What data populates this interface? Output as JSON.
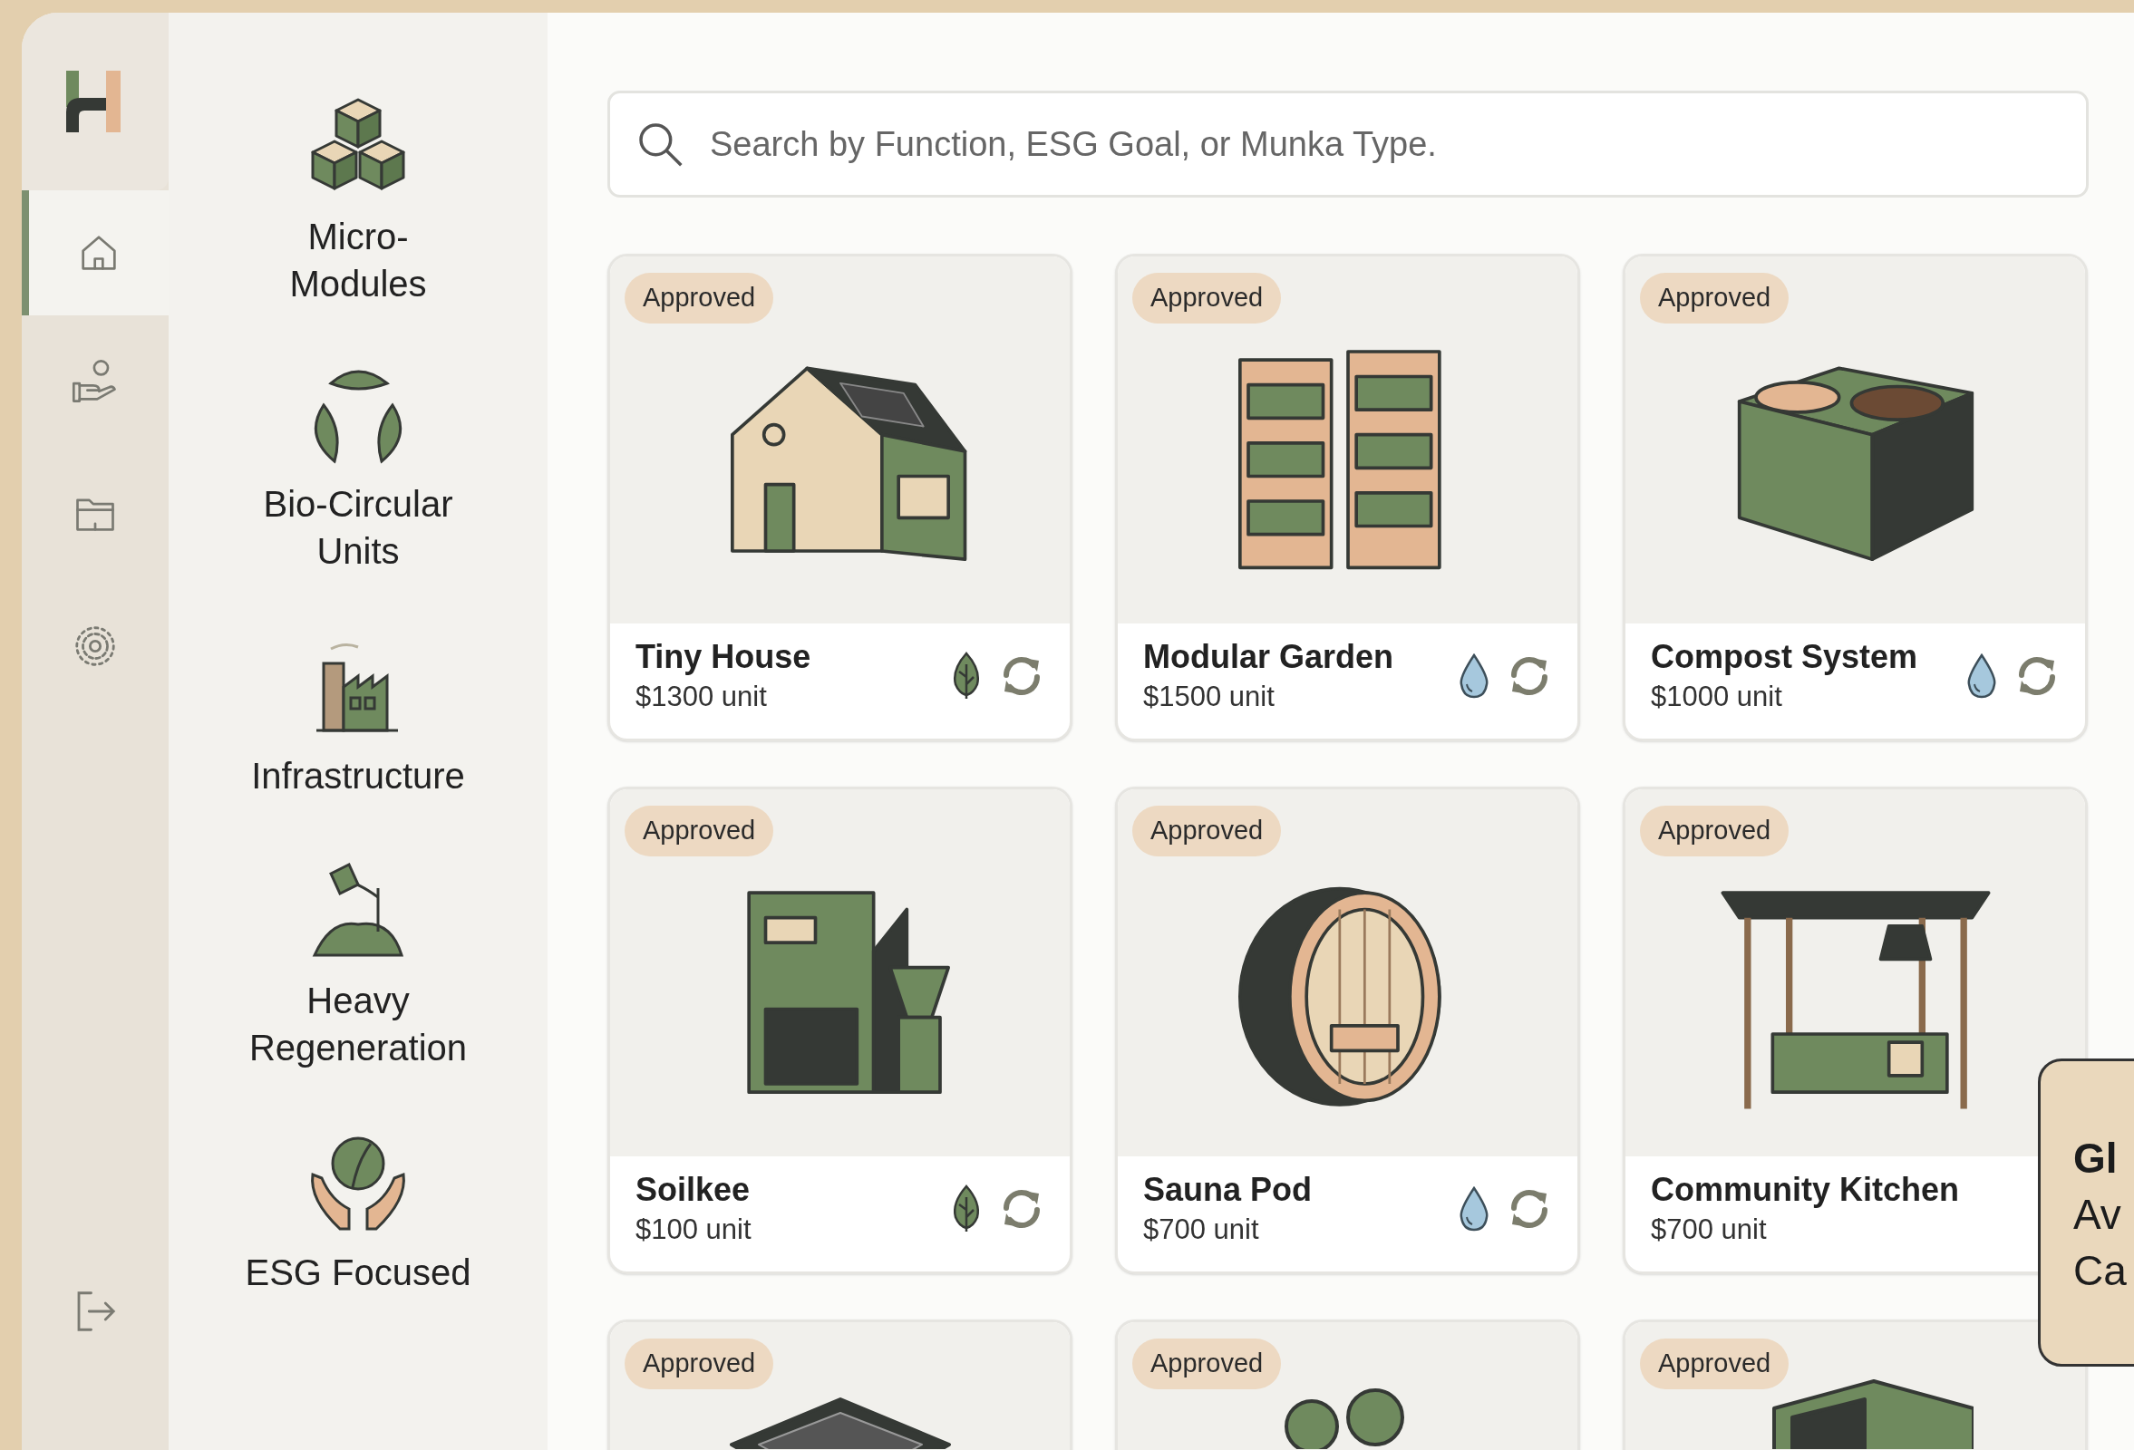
{
  "rail": {
    "items": [
      {
        "kind": "home",
        "selected": true
      },
      {
        "kind": "hand",
        "selected": false
      },
      {
        "kind": "folder",
        "selected": false
      },
      {
        "kind": "settings",
        "selected": false
      }
    ]
  },
  "categories": [
    {
      "label": "Micro-Modules"
    },
    {
      "label": "Bio-Circular Units"
    },
    {
      "label": "Infrastructure"
    },
    {
      "label": "Heavy Regeneration"
    },
    {
      "label": "ESG Focused"
    }
  ],
  "search": {
    "placeholder": "Search by Function, ESG Goal, or Munka Type."
  },
  "cards": [
    {
      "badge": "Approved",
      "name": "Tiny House",
      "price": "$1300 unit",
      "tags": [
        {
          "kind": "leaf"
        },
        {
          "kind": "recycle"
        }
      ]
    },
    {
      "badge": "Approved",
      "name": "Modular Garden",
      "price": "$1500 unit",
      "tags": [
        {
          "kind": "drop"
        },
        {
          "kind": "recycle"
        }
      ]
    },
    {
      "badge": "Approved",
      "name": "Compost System",
      "price": "$1000 unit",
      "tags": [
        {
          "kind": "drop"
        },
        {
          "kind": "recycle"
        }
      ]
    },
    {
      "badge": "Approved",
      "name": "Soilkee",
      "price": "$100 unit",
      "tags": [
        {
          "kind": "leaf"
        },
        {
          "kind": "recycle"
        }
      ]
    },
    {
      "badge": "Approved",
      "name": "Sauna Pod",
      "price": "$700 unit",
      "tags": [
        {
          "kind": "drop"
        },
        {
          "kind": "recycle"
        }
      ]
    },
    {
      "badge": "Approved",
      "name": "Community Kitchen",
      "price": "$700 unit"
    },
    {
      "badge": "Approved"
    },
    {
      "badge": "Approved"
    },
    {
      "badge": "Approved"
    }
  ],
  "popup": {
    "lines": [
      "Gl",
      "Av",
      "Ca"
    ]
  }
}
